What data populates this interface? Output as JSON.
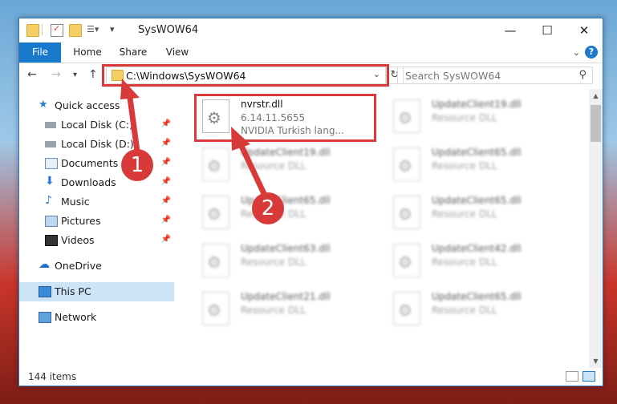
{
  "window": {
    "title": "SysWOW64",
    "minimize": "—",
    "maximize": "☐",
    "close": "✕"
  },
  "ribbon": {
    "tabs": [
      "File",
      "Home",
      "Share",
      "View"
    ],
    "help": "?"
  },
  "address_bar": {
    "path": "C:\\Windows\\SysWOW64",
    "search_placeholder": "Search SysWOW64"
  },
  "sidebar": {
    "items": [
      {
        "label": "Quick access",
        "icon": "star-icon"
      },
      {
        "label": "Local Disk (C:)",
        "icon": "drive-icon",
        "pinned": true
      },
      {
        "label": "Local Disk (D:)",
        "icon": "drive-icon",
        "pinned": true
      },
      {
        "label": "Documents",
        "icon": "documents-icon",
        "pinned": true
      },
      {
        "label": "Downloads",
        "icon": "downloads-icon",
        "pinned": true
      },
      {
        "label": "Music",
        "icon": "music-icon",
        "pinned": true
      },
      {
        "label": "Pictures",
        "icon": "pictures-icon",
        "pinned": true
      },
      {
        "label": "Videos",
        "icon": "videos-icon",
        "pinned": true
      },
      {
        "label": "OneDrive",
        "icon": "cloud-icon"
      },
      {
        "label": "This PC",
        "icon": "computer-icon",
        "selected": true
      },
      {
        "label": "Network",
        "icon": "network-icon"
      }
    ]
  },
  "files": [
    {
      "name": "nvrstr.dll",
      "line2": "6.14.11.5655",
      "line3": "NVIDIA Turkish lang...",
      "highlighted": true
    },
    {
      "name": "UpdateClient19.dll",
      "line2": "Resource DLL"
    },
    {
      "name": "UpdateClient19.dll",
      "line2": "Resource DLL"
    },
    {
      "name": "UpdateClient65.dll",
      "line2": "Resource DLL"
    },
    {
      "name": "UpdateClient65.dll",
      "line2": "Resource DLL"
    },
    {
      "name": "UpdateClient65.dll",
      "line2": "Resource DLL"
    },
    {
      "name": "UpdateClient63.dll",
      "line2": "Resource DLL"
    },
    {
      "name": "UpdateClient42.dll",
      "line2": "Resource DLL"
    },
    {
      "name": "UpdateClient21.dll",
      "line2": "Resource DLL"
    },
    {
      "name": "UpdateClient65.dll",
      "line2": "Resource DLL"
    }
  ],
  "status": {
    "item_count": "144 items"
  },
  "annotations": {
    "callout_1": "1",
    "callout_2": "2",
    "color": "#d83a3a"
  }
}
